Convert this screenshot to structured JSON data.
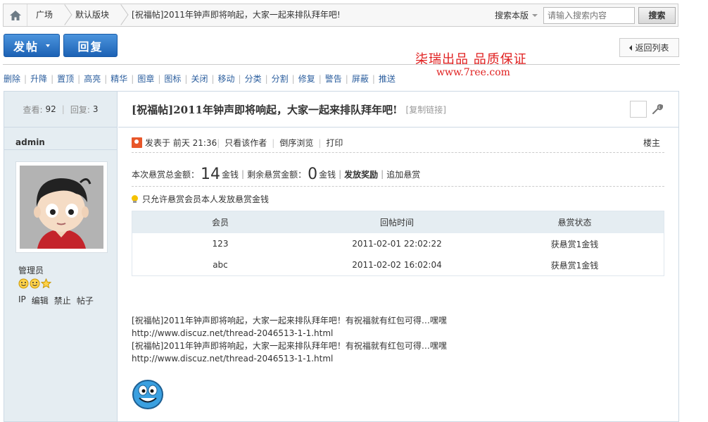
{
  "breadcrumb": {
    "items": [
      "广场",
      "默认版块",
      "[祝福帖]2011年钟声即将响起，大家一起来排队拜年吧!"
    ]
  },
  "search": {
    "scope": "搜索本版",
    "placeholder": "请输入搜索内容",
    "button": "搜索"
  },
  "actions": {
    "post": "发帖",
    "reply": "回复",
    "back": "返回列表"
  },
  "promo": {
    "line1": "柒瑞出品    品质保证",
    "line2": "www.7ree.com"
  },
  "mod_tools": [
    "删除",
    "升降",
    "置顶",
    "高亮",
    "精华",
    "图章",
    "图标",
    "关闭",
    "移动",
    "分类",
    "分割",
    "修复",
    "警告",
    "屏蔽",
    "推送"
  ],
  "stats": {
    "views_label": "查看:",
    "views": "92",
    "replies_label": "回复:",
    "replies": "3"
  },
  "author": {
    "name": "admin",
    "group": "管理员",
    "links": [
      "IP",
      "编辑",
      "禁止",
      "帖子"
    ]
  },
  "thread": {
    "title": "[祝福帖]2011年钟声即将响起，大家一起来排队拜年吧!",
    "copy_link": "[复制链接]"
  },
  "post_meta": {
    "posted": "发表于 前天 21:36",
    "only_author": "只看该作者",
    "reverse": "倒序浏览",
    "print": "打印",
    "floor": "楼主"
  },
  "reward": {
    "total_label": "本次悬赏总金额：",
    "total": "14",
    "unit": "金钱",
    "remain_label": "剩余悬赏金额：",
    "remain": "0",
    "grant": "发放奖励",
    "add": "追加悬赏"
  },
  "tip": "只允许悬赏会员本人发放悬赏金钱",
  "reward_table": {
    "headers": [
      "会员",
      "回帖时间",
      "悬赏状态"
    ],
    "rows": [
      [
        "123",
        "2011-02-01 22:02:22",
        "获悬赏1金钱"
      ],
      [
        "abc",
        "2011-02-02 16:02:04",
        "获悬赏1金钱"
      ]
    ]
  },
  "body_lines": [
    "[祝福帖]2011年钟声即将响起，大家一起来排队拜年吧！有祝福就有红包可得…嘿嘿",
    "http://www.discuz.net/thread-2046513-1-1.html",
    "[祝福帖]2011年钟声即将响起，大家一起来排队拜年吧！有祝福就有红包可得…嘿嘿",
    "http://www.discuz.net/thread-2046513-1-1.html"
  ],
  "colors": {
    "primary_button": "#2a6fc4",
    "link": "#2b5e9e",
    "promo": "#e02020",
    "sidebar_bg": "#e5edf2"
  }
}
